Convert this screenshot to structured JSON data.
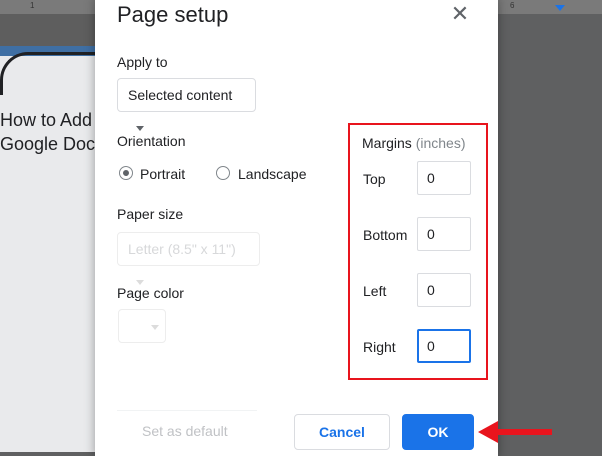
{
  "background_doc": {
    "text_line1": "How to Add",
    "text_line2": "Google Docs",
    "ruler_left": "1",
    "ruler_right": "6"
  },
  "dialog": {
    "title": "Page setup",
    "close_icon": "close-icon",
    "apply_to": {
      "label": "Apply to",
      "value": "Selected content"
    },
    "orientation": {
      "label": "Orientation",
      "options": [
        "Portrait",
        "Landscape"
      ],
      "selected": "Portrait"
    },
    "paper_size": {
      "label": "Paper size",
      "value": "Letter (8.5\" x 11\")"
    },
    "page_color": {
      "label": "Page color"
    },
    "margins": {
      "label": "Margins",
      "unit": "(inches)",
      "top": {
        "label": "Top",
        "value": "0"
      },
      "bottom": {
        "label": "Bottom",
        "value": "0"
      },
      "left": {
        "label": "Left",
        "value": "0"
      },
      "right": {
        "label": "Right",
        "value": "0"
      }
    },
    "buttons": {
      "set_default": "Set as default",
      "cancel": "Cancel",
      "ok": "OK"
    }
  },
  "colors": {
    "accent": "#1a73e8",
    "highlight": "#e8141d"
  }
}
